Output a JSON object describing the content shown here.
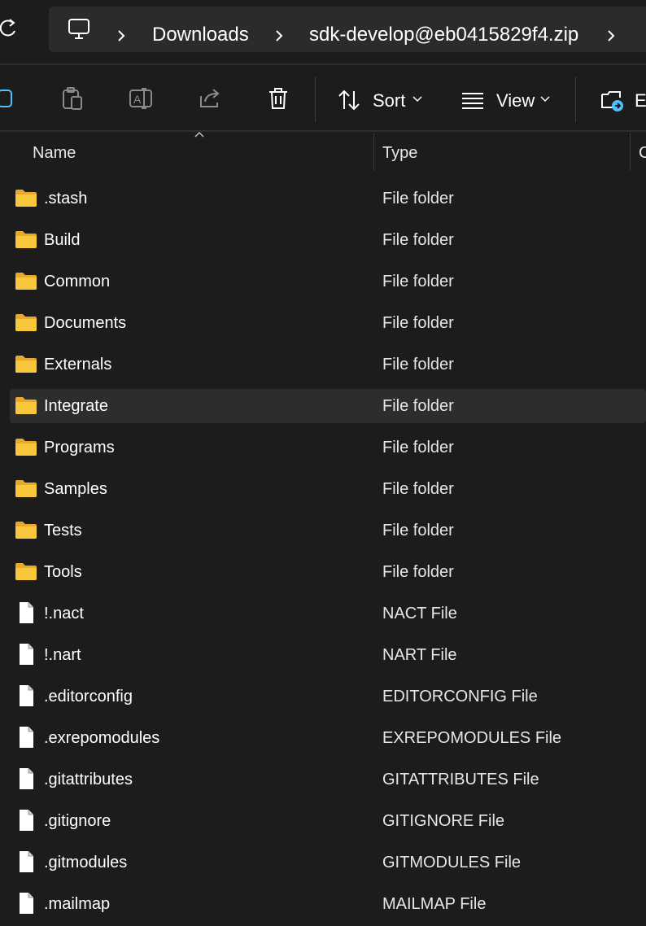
{
  "breadcrumb": {
    "items": [
      "Downloads",
      "sdk-develop@eb0415829f4.zip"
    ]
  },
  "toolbar": {
    "sort_label": "Sort",
    "view_label": "View",
    "extract_label": "Ex"
  },
  "columns": {
    "name": "Name",
    "type": "Type",
    "third": "C"
  },
  "files": [
    {
      "name": ".stash",
      "type": "File folder",
      "kind": "folder"
    },
    {
      "name": "Build",
      "type": "File folder",
      "kind": "folder"
    },
    {
      "name": "Common",
      "type": "File folder",
      "kind": "folder"
    },
    {
      "name": "Documents",
      "type": "File folder",
      "kind": "folder"
    },
    {
      "name": "Externals",
      "type": "File folder",
      "kind": "folder"
    },
    {
      "name": "Integrate",
      "type": "File folder",
      "kind": "folder",
      "selected": true
    },
    {
      "name": "Programs",
      "type": "File folder",
      "kind": "folder"
    },
    {
      "name": "Samples",
      "type": "File folder",
      "kind": "folder"
    },
    {
      "name": "Tests",
      "type": "File folder",
      "kind": "folder"
    },
    {
      "name": "Tools",
      "type": "File folder",
      "kind": "folder"
    },
    {
      "name": "!.nact",
      "type": "NACT File",
      "kind": "file"
    },
    {
      "name": "!.nart",
      "type": "NART File",
      "kind": "file"
    },
    {
      "name": ".editorconfig",
      "type": "EDITORCONFIG File",
      "kind": "file"
    },
    {
      "name": ".exrepomodules",
      "type": "EXREPOMODULES File",
      "kind": "file"
    },
    {
      "name": ".gitattributes",
      "type": "GITATTRIBUTES File",
      "kind": "file"
    },
    {
      "name": ".gitignore",
      "type": "GITIGNORE File",
      "kind": "file"
    },
    {
      "name": ".gitmodules",
      "type": "GITMODULES File",
      "kind": "file"
    },
    {
      "name": ".mailmap",
      "type": "MAILMAP File",
      "kind": "file"
    }
  ],
  "colors": {
    "background": "#1c1c1c",
    "address_bg": "#2b2b2b",
    "selected_row": "#2d2d2d",
    "folder": "#f8c73e",
    "accent": "#4cc2ff"
  }
}
